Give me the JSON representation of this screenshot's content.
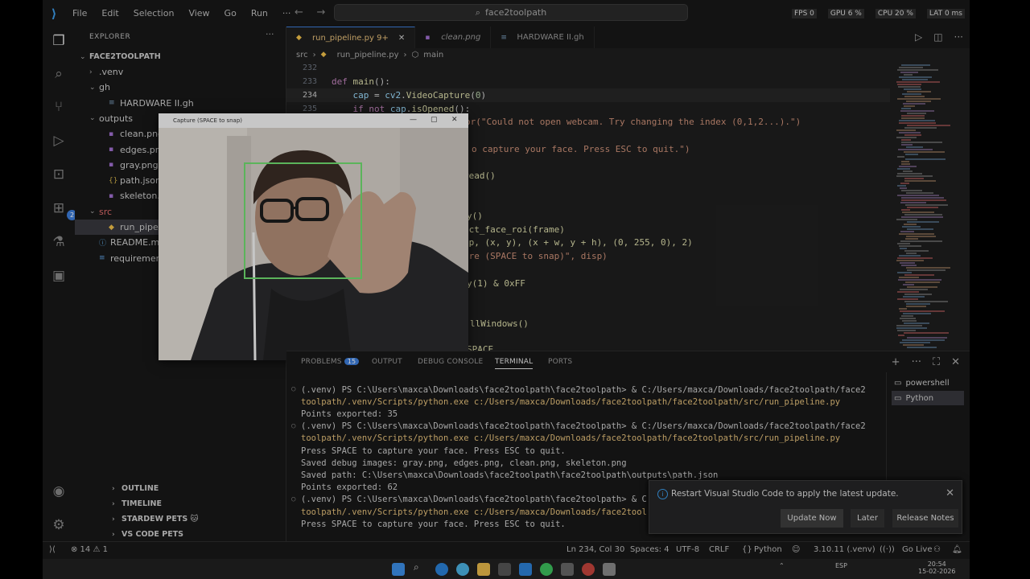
{
  "titlebar": {
    "menu": [
      "File",
      "Edit",
      "Selection",
      "View",
      "Go",
      "Run",
      "···"
    ],
    "search_text": "face2toolpath",
    "hud": [
      "FPS 0",
      "GPU 6 %",
      "CPU 20 %",
      "LAT 0 ms"
    ]
  },
  "sidebar": {
    "title": "EXPLORER",
    "root": "FACE2TOOLPATH",
    "tree": [
      {
        "label": ".venv",
        "type": "folder",
        "indent": 1,
        "open": false
      },
      {
        "label": "gh",
        "type": "folder",
        "indent": 1,
        "open": true
      },
      {
        "label": "HARDWARE II.gh",
        "type": "gh",
        "indent": 2
      },
      {
        "label": "outputs",
        "type": "folder",
        "indent": 1,
        "open": true
      },
      {
        "label": "clean.png",
        "type": "png",
        "indent": 2
      },
      {
        "label": "edges.png",
        "type": "png",
        "indent": 2
      },
      {
        "label": "gray.png",
        "type": "png",
        "indent": 2
      },
      {
        "label": "path.json",
        "type": "json",
        "indent": 2
      },
      {
        "label": "skeleton.png",
        "type": "png",
        "indent": 2
      },
      {
        "label": "src",
        "type": "folder",
        "indent": 1,
        "open": true
      },
      {
        "label": "run_pipeline.py",
        "type": "py",
        "indent": 2,
        "selected": true
      },
      {
        "label": "README.md",
        "type": "md",
        "indent": 1
      },
      {
        "label": "requirements.txt",
        "type": "txt",
        "indent": 1
      }
    ],
    "sections": [
      "OUTLINE",
      "TIMELINE",
      "STARDEW PETS 🐱",
      "VS CODE PETS"
    ]
  },
  "tabs": [
    {
      "label": "run_pipeline.py 9+",
      "active": true
    },
    {
      "label": "clean.png",
      "active": false
    },
    {
      "label": "HARDWARE II.gh",
      "active": false
    }
  ],
  "breadcrumb": [
    "src",
    "run_pipeline.py",
    "main"
  ],
  "code": {
    "line_numbers": [
      "232",
      "233",
      "234",
      "235"
    ],
    "current_line": "234",
    "fragments": [
      "or(\"Could not open webcam. Try changing the index (0,1,2...).\")",
      "o capture your face. Press ESC to quit.\")",
      "read()",
      "y()",
      "ect_face_roi(frame)",
      "sp, (x, y), (x + w, y + h), (0, 255, 0), 2)",
      "ure (SPACE to snap)\", disp)",
      "y(1) & 0xFF",
      "llWindows()",
      "SPACE"
    ]
  },
  "panel": {
    "tabs": [
      "PROBLEMS",
      "OUTPUT",
      "DEBUG CONSOLE",
      "TERMINAL",
      "PORTS"
    ],
    "problems_count": "15",
    "active_tab": "TERMINAL",
    "terminal_lines": [
      "(.venv) PS C:\\Users\\maxca\\Downloads\\face2toolpath\\face2toolpath> & C:/Users/maxca/Downloads/face2toolpath/face2",
      "toolpath/.venv/Scripts/python.exe c:/Users/maxca/Downloads/face2toolpath/face2toolpath/src/run_pipeline.py",
      "Points exported: 35",
      "(.venv) PS C:\\Users\\maxca\\Downloads\\face2toolpath\\face2toolpath> & C:/Users/maxca/Downloads/face2toolpath/face2",
      "toolpath/.venv/Scripts/python.exe c:/Users/maxca/Downloads/face2toolpath/face2toolpath/src/run_pipeline.py",
      "Press SPACE to capture your face. Press ESC to quit.",
      "Saved debug images: gray.png, edges.png, clean.png, skeleton.png",
      "Saved path: C:\\Users\\maxca\\Downloads\\face2toolpath\\face2toolpath\\outputs\\path.json",
      "Points exported: 62",
      "(.venv) PS C:\\Users\\maxca\\Downloads\\face2toolpath\\face2toolpath> & C",
      "toolpath/.venv/Scripts/python.exe c:/Users/maxca/Downloads/face2tool",
      "Press SPACE to capture your face. Press ESC to quit."
    ],
    "terminals": [
      "powershell",
      "Python"
    ]
  },
  "notification": {
    "message": "Restart Visual Studio Code to apply the latest update.",
    "buttons": [
      "Update Now",
      "Later",
      "Release Notes"
    ]
  },
  "statusbar": {
    "problems": "⊗ 14 ⚠ 1",
    "position": "Ln 234, Col 30",
    "spaces": "Spaces: 4",
    "encoding": "UTF-8",
    "eol": "CRLF",
    "language": "Python",
    "interpreter": "3.10.11 (.venv)",
    "golive": "Go Live"
  },
  "camera": {
    "title": "Capture (SPACE to snap)"
  },
  "taskbar": {
    "time": "20:54",
    "date": "15-02-2026",
    "lang": "ESP"
  },
  "colors": {
    "accent": "#3c7dd9",
    "face_box": "#6fdc6f"
  }
}
